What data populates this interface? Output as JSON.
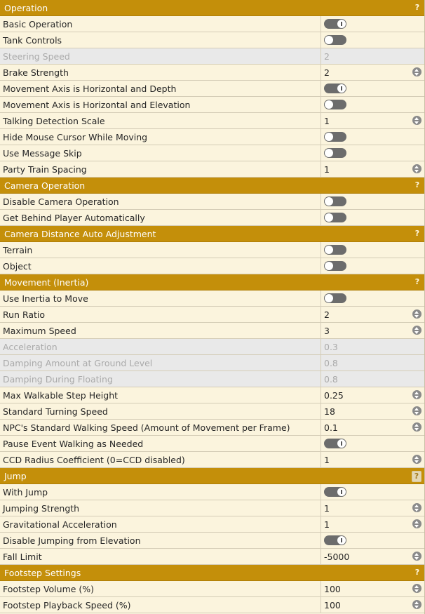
{
  "colors": {
    "section_header_bg": "#c48f0a",
    "row_bg": "#fbf4dd",
    "disabled_row_bg": "#e9e9e9",
    "toggle_track": "#6c6c6c"
  },
  "sections": [
    {
      "title": "Operation",
      "help": "?",
      "rows": [
        {
          "label": "Basic Operation",
          "type": "toggle",
          "checked": true
        },
        {
          "label": "Tank Controls",
          "type": "toggle",
          "checked": false
        },
        {
          "label": "Steering Speed",
          "type": "text",
          "value": "2",
          "disabled": true
        },
        {
          "label": "Brake Strength",
          "type": "number",
          "value": "2"
        },
        {
          "label": "Movement Axis is Horizontal and Depth",
          "type": "toggle",
          "checked": true
        },
        {
          "label": "Movement Axis is Horizontal and Elevation",
          "type": "toggle",
          "checked": false
        },
        {
          "label": "Talking Detection Scale",
          "type": "number",
          "value": "1"
        },
        {
          "label": "Hide Mouse Cursor While Moving",
          "type": "toggle",
          "checked": false
        },
        {
          "label": "Use Message Skip",
          "type": "toggle",
          "checked": false
        },
        {
          "label": "Party Train Spacing",
          "type": "number",
          "value": "1"
        }
      ]
    },
    {
      "title": "Camera Operation",
      "help": "?",
      "rows": [
        {
          "label": "Disable Camera Operation",
          "type": "toggle",
          "checked": false
        },
        {
          "label": "Get Behind Player Automatically",
          "type": "toggle",
          "checked": false
        }
      ]
    },
    {
      "title": "Camera Distance Auto Adjustment",
      "help": "?",
      "rows": [
        {
          "label": "Terrain",
          "type": "toggle",
          "checked": false
        },
        {
          "label": "Object",
          "type": "toggle",
          "checked": false
        }
      ]
    },
    {
      "title": "Movement (Inertia)",
      "help": "?",
      "rows": [
        {
          "label": "Use Inertia to Move",
          "type": "toggle",
          "checked": false
        },
        {
          "label": "Run Ratio",
          "type": "number",
          "value": "2"
        },
        {
          "label": "Maximum Speed",
          "type": "number",
          "value": "3"
        },
        {
          "label": "Acceleration",
          "type": "text",
          "value": "0.3",
          "disabled": true
        },
        {
          "label": "Damping Amount at Ground Level",
          "type": "text",
          "value": "0.8",
          "disabled": true
        },
        {
          "label": "Damping During Floating",
          "type": "text",
          "value": "0.8",
          "disabled": true
        },
        {
          "label": "Max Walkable Step Height",
          "type": "number",
          "value": "0.25"
        },
        {
          "label": "Standard Turning Speed",
          "type": "number",
          "value": "18"
        },
        {
          "label": "NPC's Standard Walking Speed (Amount of Movement per Frame)",
          "type": "number",
          "value": "0.1"
        },
        {
          "label": "Pause Event Walking as Needed",
          "type": "toggle",
          "checked": true
        },
        {
          "label": "CCD Radius Coefficient (0=CCD disabled)",
          "type": "number",
          "value": "1"
        }
      ]
    },
    {
      "title": "Jump",
      "help": "?",
      "help_boxed": true,
      "rows": [
        {
          "label": "With Jump",
          "type": "toggle",
          "checked": true
        },
        {
          "label": "Jumping Strength",
          "type": "number",
          "value": "1"
        },
        {
          "label": "Gravitational Acceleration",
          "type": "number",
          "value": "1"
        },
        {
          "label": "Disable Jumping from Elevation",
          "type": "toggle",
          "checked": true
        },
        {
          "label": "Fall Limit",
          "type": "number",
          "value": "-5000"
        }
      ]
    },
    {
      "title": "Footstep Settings",
      "help": "?",
      "rows": [
        {
          "label": "Footstep Volume (%)",
          "type": "number",
          "value": "100"
        },
        {
          "label": "Footstep Playback Speed (%)",
          "type": "number",
          "value": "100"
        }
      ]
    }
  ]
}
